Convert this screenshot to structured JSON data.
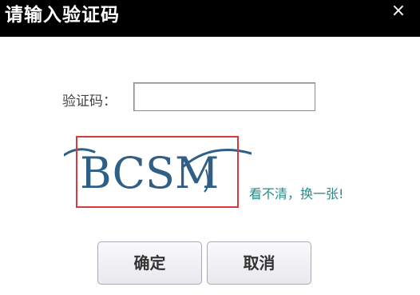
{
  "dialog": {
    "title": "请输入验证码",
    "close_label": "×"
  },
  "form": {
    "label": "验证码：",
    "input_value": "",
    "input_placeholder": ""
  },
  "captcha": {
    "text": "BCSM",
    "refresh_label": "看不清，换一张!"
  },
  "buttons": {
    "confirm_label": "确定",
    "cancel_label": "取消"
  },
  "colors": {
    "titlebar": "#000000",
    "captcha_text": "#2f5f86",
    "highlight_border": "#d63a3a",
    "refresh_link": "#2a8a86"
  }
}
